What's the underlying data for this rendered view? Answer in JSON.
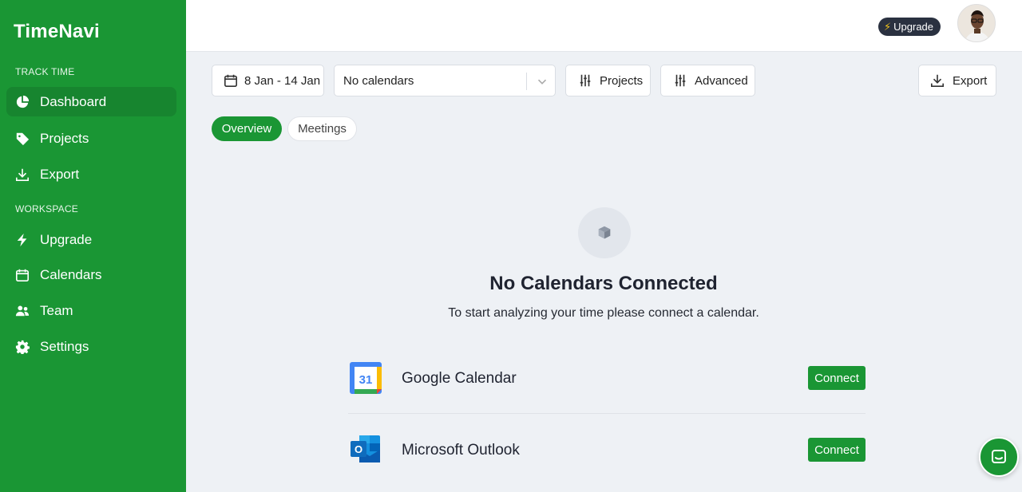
{
  "app": {
    "logo": "TimeNavi"
  },
  "sidebar": {
    "sections": [
      {
        "label": "TRACK TIME"
      },
      {
        "label": "WORKSPACE"
      }
    ],
    "items": [
      {
        "label": "Dashboard",
        "icon": "pie-chart-icon",
        "active": true
      },
      {
        "label": "Projects",
        "icon": "tag-icon"
      },
      {
        "label": "Export",
        "icon": "download-icon"
      },
      {
        "label": "Upgrade",
        "icon": "bolt-icon"
      },
      {
        "label": "Calendars",
        "icon": "calendar-icon"
      },
      {
        "label": "Team",
        "icon": "users-icon"
      },
      {
        "label": "Settings",
        "icon": "gear-icon"
      }
    ]
  },
  "header": {
    "upgrade_label": "Upgrade"
  },
  "toolbar": {
    "date_range": "8 Jan - 14 Jan",
    "calendar_select": "No calendars",
    "projects_label": "Projects",
    "advanced_label": "Advanced",
    "export_label": "Export"
  },
  "tabs": [
    {
      "label": "Overview",
      "active": true
    },
    {
      "label": "Meetings",
      "active": false
    }
  ],
  "empty_state": {
    "icon": "cube-icon",
    "title": "No Calendars Connected",
    "subtitle": "To start analyzing your time please connect a calendar."
  },
  "providers": [
    {
      "name": "Google Calendar",
      "badge": "31",
      "action": "Connect"
    },
    {
      "name": "Microsoft Outlook",
      "badge": "O",
      "action": "Connect"
    }
  ],
  "colors": {
    "brand": "#1a9634",
    "brand_dark": "#17852f",
    "pill": "#2a3140"
  }
}
